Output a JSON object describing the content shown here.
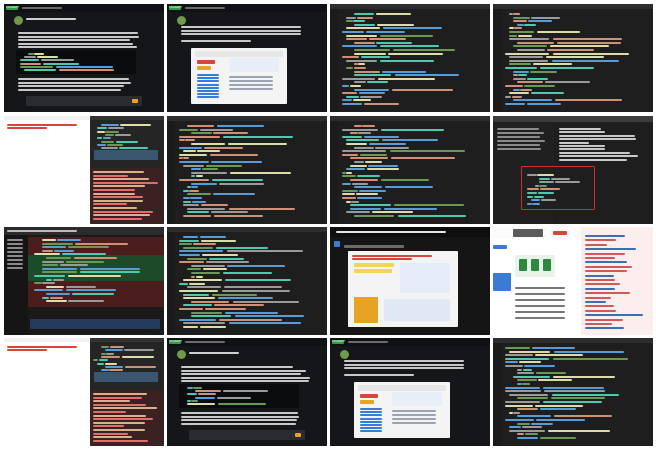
{
  "grid": {
    "columns": 4,
    "rows": 4,
    "background": "#ffffff"
  },
  "palette": {
    "chat_bg": "#14161a",
    "editor_bg": "#1e1e1e",
    "editor_alt": "#202124",
    "panel_bg": "#252526",
    "white": "#ffffff",
    "diff_red": "#4b1d1d",
    "diff_green": "#1d4b2a",
    "accent_blue": "#3a7bd5",
    "accent_orange": "#e7a324",
    "accent_red": "#d9453b",
    "highlight_box": "#d22b2b",
    "code_yellow": "#dcdcaa",
    "code_blue": "#569cd6",
    "code_teal": "#4ec9b0",
    "code_orange": "#ce9178",
    "code_green": "#6a9955",
    "gray_text": "#9a9a9a"
  },
  "tiles": [
    {
      "kind": "chat",
      "label": "chat-window",
      "badge": "ChatGPT"
    },
    {
      "kind": "chat-screenshot",
      "label": "chat-with-screenshot",
      "badge": "ChatGPT"
    },
    {
      "kind": "code",
      "label": "code-editor",
      "badge": ""
    },
    {
      "kind": "code",
      "label": "code-editor",
      "badge": ""
    },
    {
      "kind": "browser-devtools",
      "label": "browser-with-devtools",
      "badge": ""
    },
    {
      "kind": "code",
      "label": "code-editor",
      "badge": ""
    },
    {
      "kind": "code",
      "label": "code-editor",
      "badge": ""
    },
    {
      "kind": "devtools-highlight",
      "label": "devtools-highlight",
      "badge": ""
    },
    {
      "kind": "diff",
      "label": "diff-view",
      "badge": ""
    },
    {
      "kind": "code",
      "label": "code-editor",
      "badge": ""
    },
    {
      "kind": "web-screenshot",
      "label": "web-screenshot",
      "badge": ""
    },
    {
      "kind": "web-page",
      "label": "web-page",
      "badge": ""
    },
    {
      "kind": "browser-devtools",
      "label": "browser-with-devtools",
      "badge": ""
    },
    {
      "kind": "chat",
      "label": "chat-window",
      "badge": "ChatGPT"
    },
    {
      "kind": "chat-screenshot",
      "label": "chat-with-screenshot",
      "badge": "ChatGPT"
    },
    {
      "kind": "code",
      "label": "code-editor",
      "badge": ""
    }
  ]
}
